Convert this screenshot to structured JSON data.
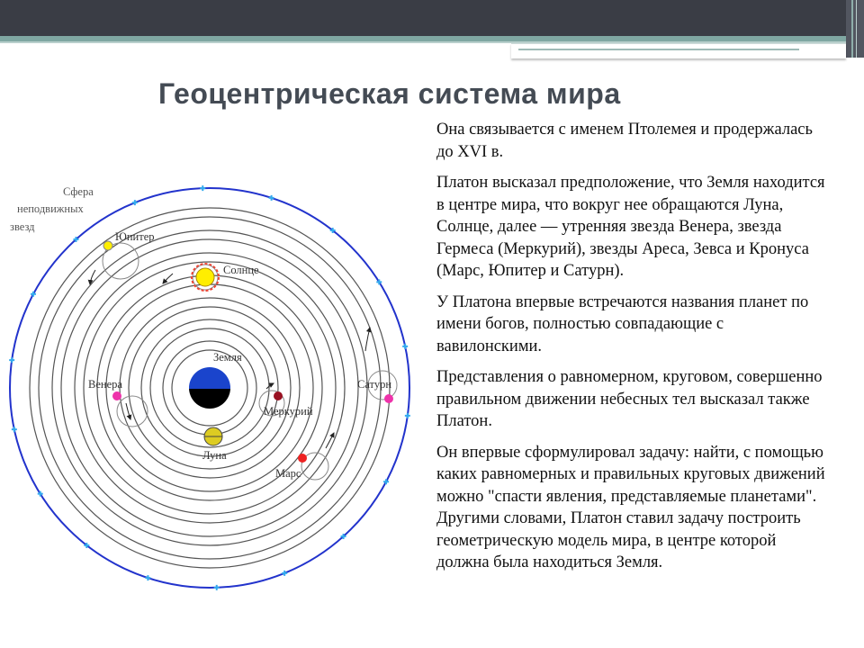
{
  "slide": {
    "title": "Геоцентрическая система мира",
    "paragraphs": [
      "Она связывается с именем Птолемея и продержалась до XVI в.",
      " Платон высказал предположение, что Земля находится в центре мира, что вокруг нее обращаются Луна, Солнце, далее — утренняя звезда Венера, звезда Гермеса (Меркурий), звезды Ареса, Зевса и Кронуса (Марс, Юпитер и Сатурн).",
      " У Платона впервые встречаются названия планет по имени богов, полностью совпадающие с вавилонскими.",
      " Представления о равномерном, круговом, совершенно правильном движении небесных тел высказал также Платон.",
      " Он впервые сформулировал задачу: найти, с помощью каких равномерных и правильных круговых движений можно \"спасти явления, представляемые планетами\". Другими словами, Платон ставил задачу построить геометрическую модель мира, в центре которой должна была находиться Земля."
    ]
  },
  "diagram": {
    "labels": {
      "sphere_line1": "Сфера",
      "sphere_line2": "неподвижных",
      "sphere_line3": "звезд",
      "jupiter": "Юпитер",
      "sun": "Солнце",
      "earth": "Земля",
      "venus": "Венера",
      "mercury": "Меркурий",
      "saturn": "Сатурн",
      "moon": "Луна",
      "mars": "Марс"
    },
    "colors": {
      "outer_sphere": "#2233cc",
      "stars": "#33aaee",
      "sun": "#ffee00",
      "sun_ring": "#ee4433",
      "earth_top": "#1a44cc",
      "earth_bottom": "#000000",
      "moon": "#ddcc22",
      "venus": "#ee33aa",
      "mercury": "#991122",
      "mars": "#ee2222",
      "jupiter": "#ffee00",
      "saturn": "#ee33aa"
    }
  }
}
